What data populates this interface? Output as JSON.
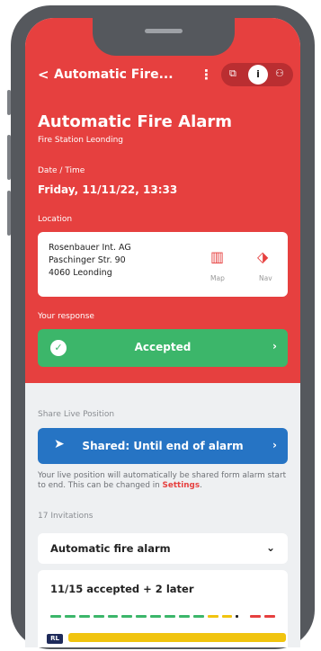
{
  "header": {
    "back_glyph": "<",
    "title": "Automatic Fire...",
    "menu_glyph": "⋮",
    "segments": [
      {
        "icon": "copy-icon",
        "glyph": "⧉"
      },
      {
        "icon": "info-icon",
        "glyph": "i",
        "active": true
      },
      {
        "icon": "people-icon",
        "glyph": "⚇"
      }
    ]
  },
  "alarm": {
    "title": "Automatic Fire Alarm",
    "station": "Fire Station Leonding",
    "datetime_label": "Date / Time",
    "datetime": "Friday, 11/11/22, 13:33",
    "location_label": "Location",
    "address": [
      "Rosenbauer Int. AG",
      "Paschinger Str. 90",
      "4060 Leonding"
    ],
    "map_label": "Map",
    "nav_label": "Nav"
  },
  "response": {
    "label": "Your response",
    "value": "Accepted"
  },
  "live_position": {
    "label": "Share Live Position",
    "button": "Shared: Until end of alarm",
    "info_text": "Your live position will automatically be shared form alarm start to end. This can be changed in ",
    "info_link": "Settings",
    "info_end": "."
  },
  "invitations": {
    "label": "17 Invitations",
    "dropdown_value": "Automatic fire alarm",
    "summary": "11/15 accepted + 2 later",
    "status_bar": {
      "accepted": 11,
      "later": 2,
      "declined": 2,
      "colors": {
        "accepted": "#3cb66a",
        "later": "#f1c40f",
        "pending": "#222222",
        "declined": "#e6403f"
      }
    },
    "row_badge": "RL"
  },
  "colors": {
    "brand_red": "#e6403f",
    "accept_green": "#3cb66a",
    "share_blue": "#2674c4",
    "bg_gray": "#eef0f2"
  }
}
